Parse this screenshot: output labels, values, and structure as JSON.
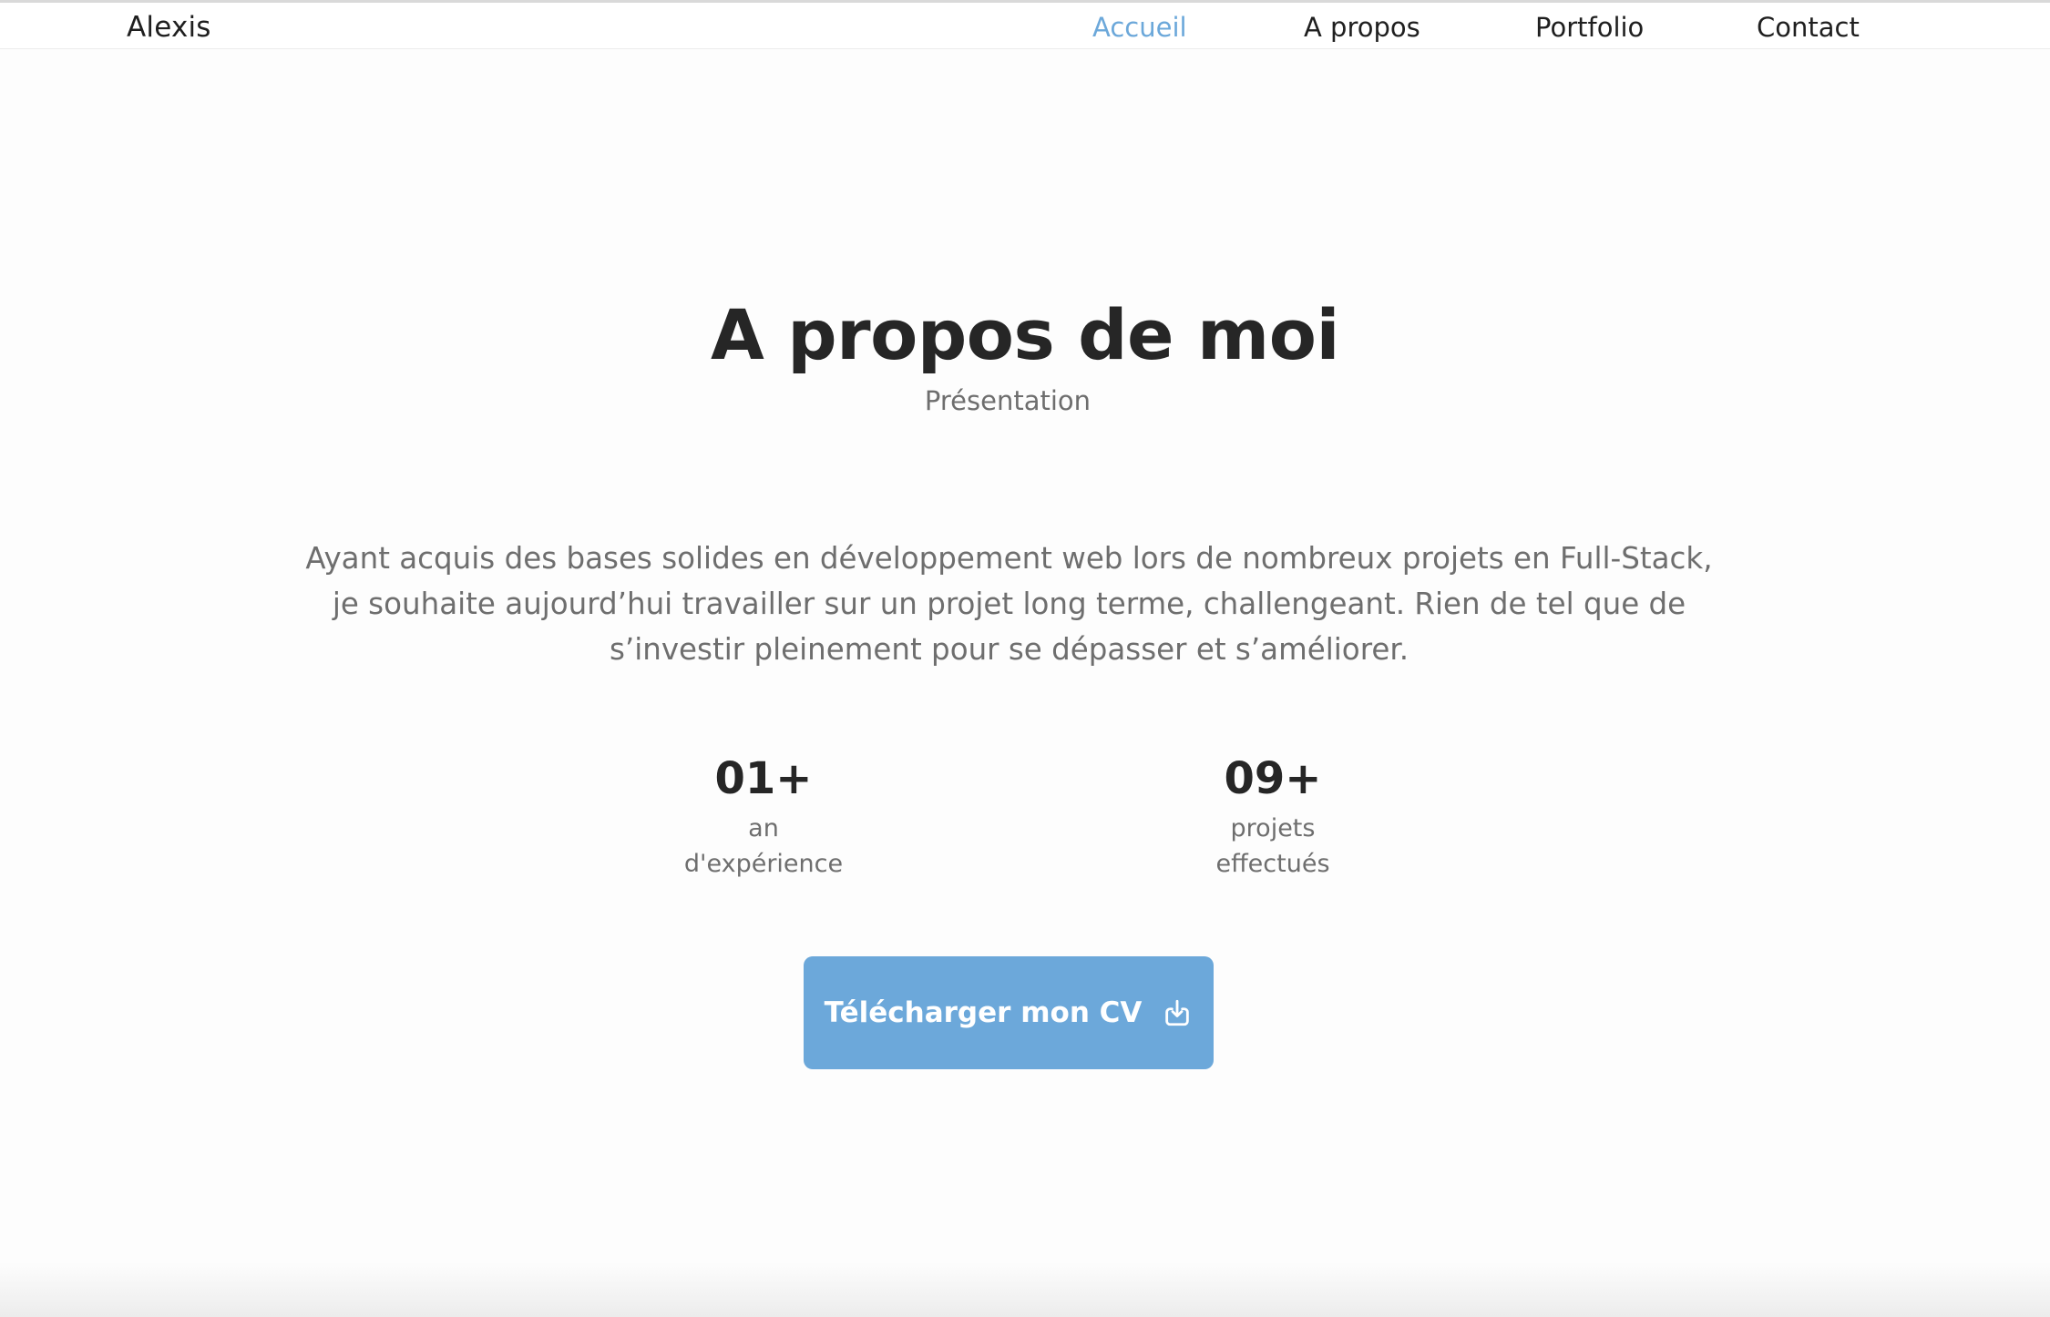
{
  "header": {
    "brand": "Alexis",
    "nav": [
      {
        "label": "Accueil",
        "active": true
      },
      {
        "label": "A propos",
        "active": false
      },
      {
        "label": "Portfolio",
        "active": false
      },
      {
        "label": "Contact",
        "active": false
      }
    ]
  },
  "about": {
    "title": "A propos de moi",
    "subtitle": "Présentation",
    "description": "Ayant acquis des bases solides en développement web lors de nombreux projets en Full-Stack, je souhaite aujourd’hui travailler sur un projet long terme, challengeant. Rien de tel que de s’investir pleinement pour se dépasser et s’améliorer.",
    "stats": [
      {
        "value": "01+",
        "label_line1": "an",
        "label_line2": "d'expérience"
      },
      {
        "value": "09+",
        "label_line1": "projets",
        "label_line2": "effectués"
      }
    ],
    "cv_button": {
      "label": "Télécharger mon CV",
      "icon": "download-icon"
    }
  },
  "colors": {
    "accent": "#6ca8da",
    "text_dark": "#262626",
    "text_muted": "#6e6e6e",
    "background": "#fdfdfd"
  }
}
